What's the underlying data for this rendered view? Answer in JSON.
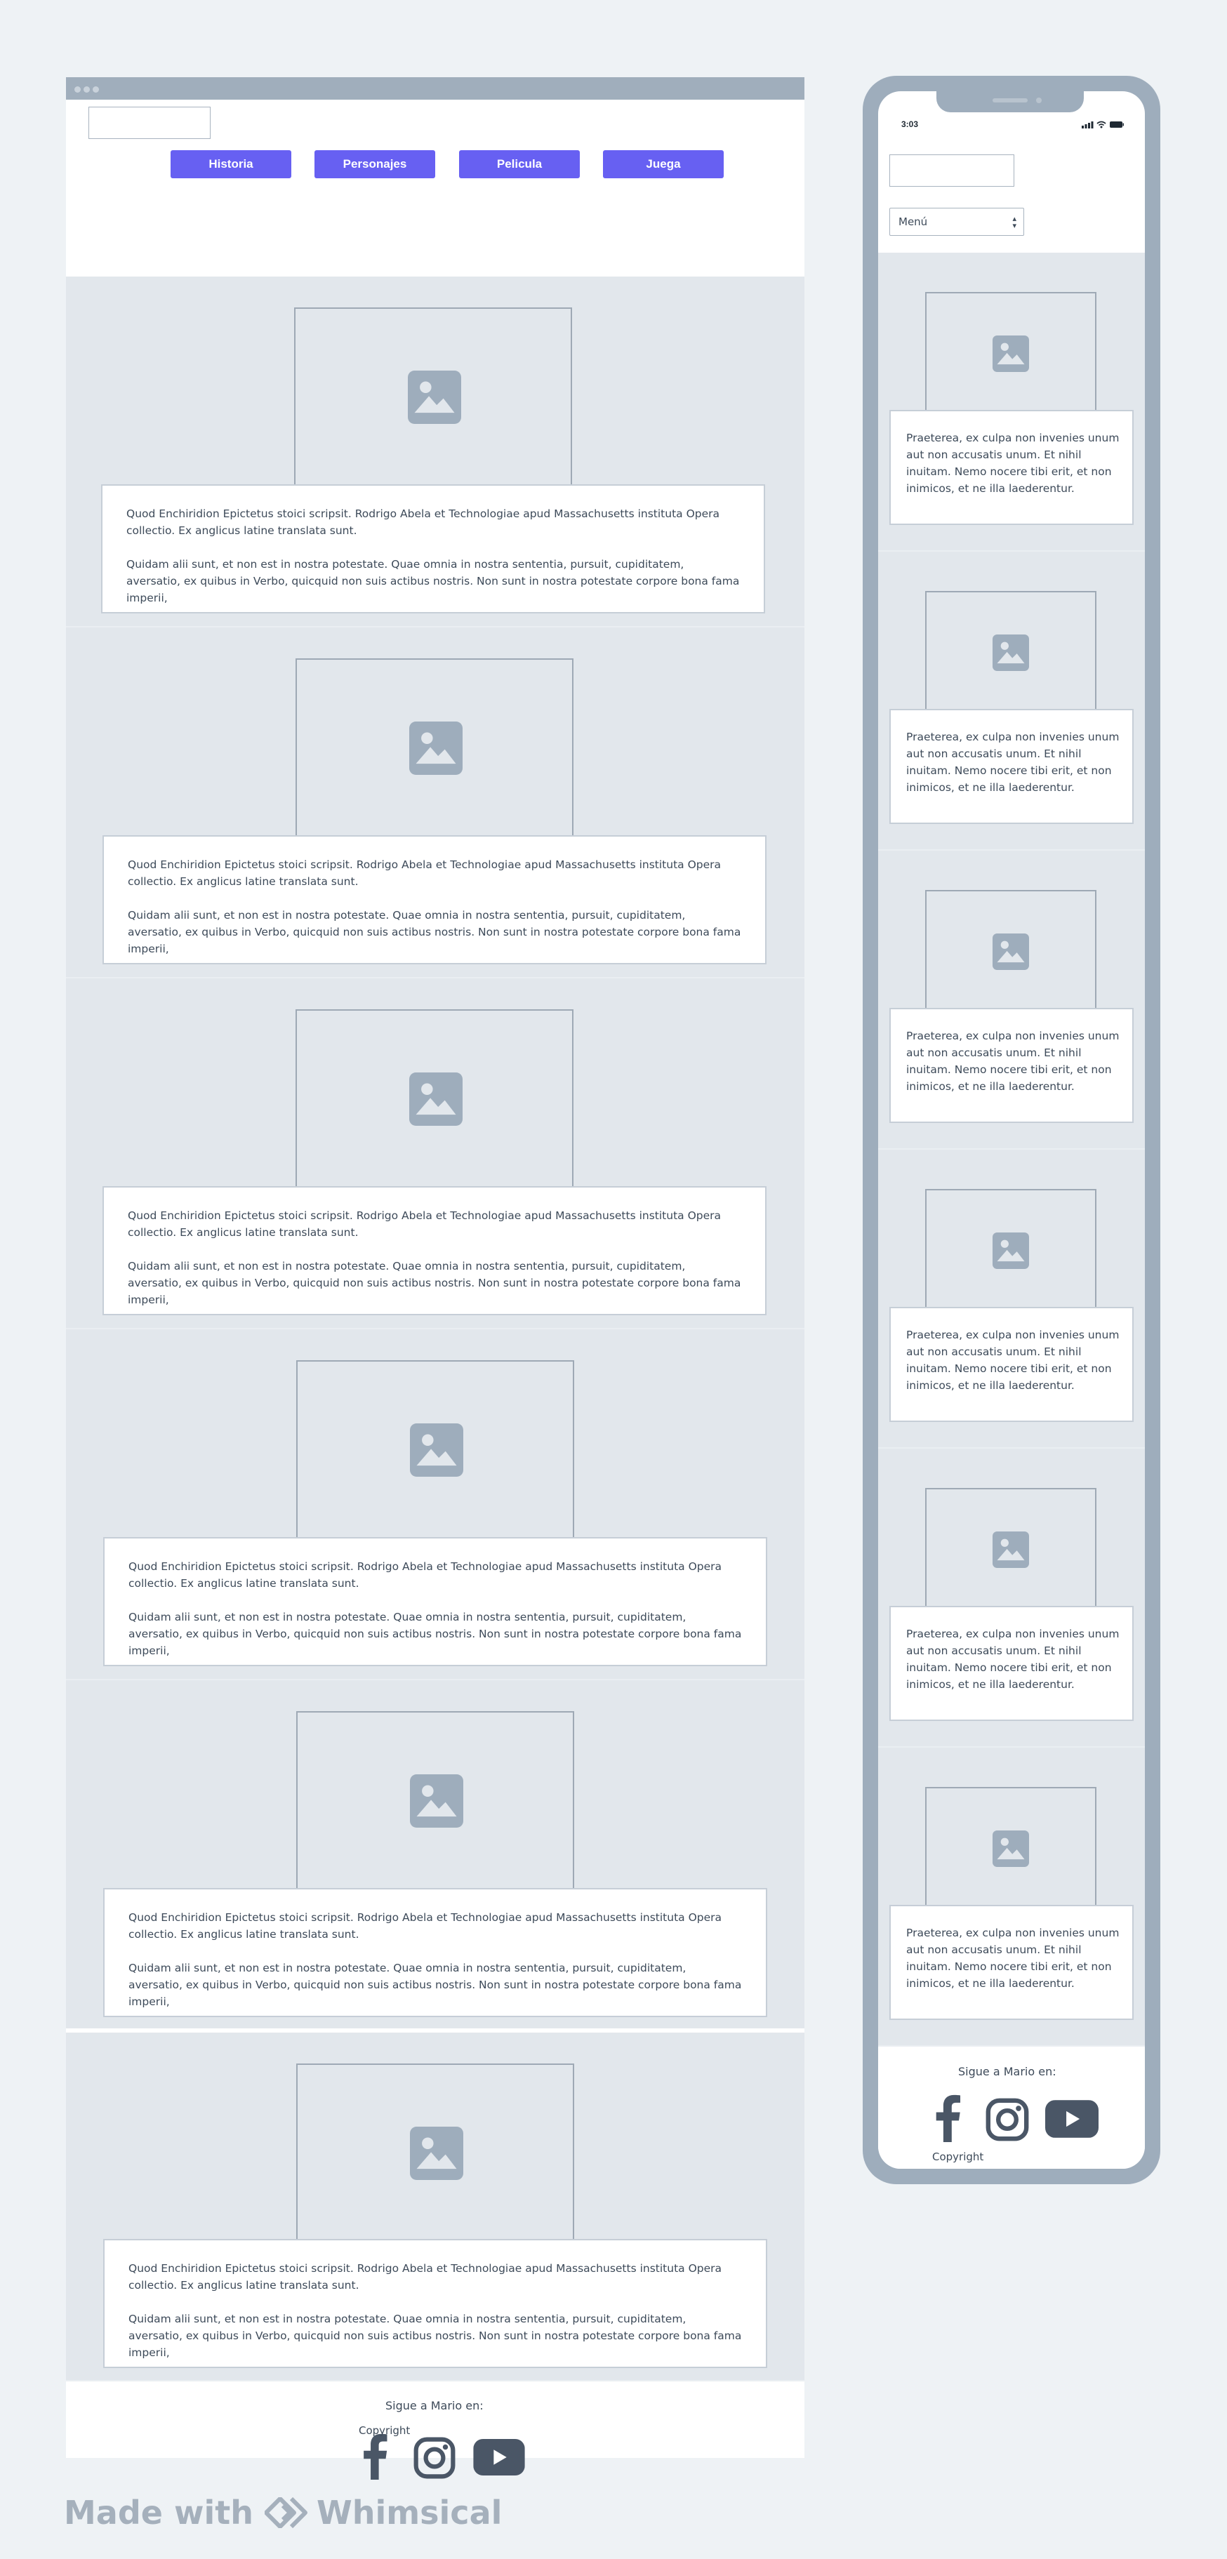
{
  "desktop": {
    "nav": [
      {
        "label": "Historia"
      },
      {
        "label": "Personajes"
      },
      {
        "label": "Pelicula"
      },
      {
        "label": "Juega"
      }
    ],
    "sections": [
      {
        "p1": "Quod Enchiridion Epictetus stoici scripsit. Rodrigo Abela et Technologiae apud Massachusetts instituta Opera collectio. Ex anglicus latine translata sunt.",
        "p2": "Quidam alii sunt, et non est in nostra potestate. Quae omnia in nostra sententia, pursuit, cupiditatem, aversatio, ex quibus in Verbo, quicquid non suis actibus nostris. Non sunt in nostra potestate corpore bona fama imperii,"
      },
      {
        "p1": "Quod Enchiridion Epictetus stoici scripsit. Rodrigo Abela et Technologiae apud Massachusetts instituta Opera collectio. Ex anglicus latine translata sunt.",
        "p2": "Quidam alii sunt, et non est in nostra potestate. Quae omnia in nostra sententia, pursuit, cupiditatem, aversatio, ex quibus in Verbo, quicquid non suis actibus nostris. Non sunt in nostra potestate corpore bona fama imperii,"
      },
      {
        "p1": "Quod Enchiridion Epictetus stoici scripsit. Rodrigo Abela et Technologiae apud Massachusetts instituta Opera collectio. Ex anglicus latine translata sunt.",
        "p2": "Quidam alii sunt, et non est in nostra potestate. Quae omnia in nostra sententia, pursuit, cupiditatem, aversatio, ex quibus in Verbo, quicquid non suis actibus nostris. Non sunt in nostra potestate corpore bona fama imperii,"
      },
      {
        "p1": "Quod Enchiridion Epictetus stoici scripsit. Rodrigo Abela et Technologiae apud Massachusetts instituta Opera collectio. Ex anglicus latine translata sunt.",
        "p2": "Quidam alii sunt, et non est in nostra potestate. Quae omnia in nostra sententia, pursuit, cupiditatem, aversatio, ex quibus in Verbo, quicquid non suis actibus nostris. Non sunt in nostra potestate corpore bona fama imperii,"
      },
      {
        "p1": "Quod Enchiridion Epictetus stoici scripsit. Rodrigo Abela et Technologiae apud Massachusetts instituta Opera collectio. Ex anglicus latine translata sunt.",
        "p2": "Quidam alii sunt, et non est in nostra potestate. Quae omnia in nostra sententia, pursuit, cupiditatem, aversatio, ex quibus in Verbo, quicquid non suis actibus nostris. Non sunt in nostra potestate corpore bona fama imperii,"
      },
      {
        "p1": "Quod Enchiridion Epictetus stoici scripsit. Rodrigo Abela et Technologiae apud Massachusetts instituta Opera collectio. Ex anglicus latine translata sunt.",
        "p2": "Quidam alii sunt, et non est in nostra potestate. Quae omnia in nostra sententia, pursuit, cupiditatem, aversatio, ex quibus in Verbo, quicquid non suis actibus nostris. Non sunt in nostra potestate corpore bona fama imperii,"
      }
    ],
    "footer": {
      "follow": "Sigue a Mario en:",
      "copyright": "Copyright"
    }
  },
  "mobile": {
    "time": "3:03",
    "menu_select": "Menú",
    "sections": [
      {
        "text": "Praeterea, ex culpa non invenies unum aut non accusatis unum. Et nihil inuitam. Nemo nocere tibi erit, et non inimicos, et ne illa laederentur."
      },
      {
        "text": "Praeterea, ex culpa non invenies unum aut non accusatis unum. Et nihil inuitam. Nemo nocere tibi erit, et non inimicos, et ne illa laederentur."
      },
      {
        "text": "Praeterea, ex culpa non invenies unum aut non accusatis unum. Et nihil inuitam. Nemo nocere tibi erit, et non inimicos, et ne illa laederentur."
      },
      {
        "text": "Praeterea, ex culpa non invenies unum aut non accusatis unum. Et nihil inuitam. Nemo nocere tibi erit, et non inimicos, et ne illa laederentur."
      },
      {
        "text": "Praeterea, ex culpa non invenies unum aut non accusatis unum. Et nihil inuitam. Nemo nocere tibi erit, et non inimicos, et ne illa laederentur."
      },
      {
        "text": "Praeterea, ex culpa non invenies unum aut non accusatis unum. Et nihil inuitam. Nemo nocere tibi erit, et non inimicos, et ne illa laederentur."
      }
    ],
    "footer": {
      "follow": "Sigue a Mario en:",
      "copyright": "Copyright"
    }
  },
  "icons": {
    "image_placeholder": "image-icon",
    "social": [
      "facebook-icon",
      "instagram-icon",
      "youtube-icon"
    ]
  },
  "watermark": {
    "made_with": "Made with",
    "brand": "Whimsical"
  },
  "colors": {
    "nav_button": "#6760f2",
    "frame": "#9eadbc",
    "section_bg": "#e2e7ec",
    "text": "#3d4a59",
    "page_bg": "#eef2f5"
  }
}
